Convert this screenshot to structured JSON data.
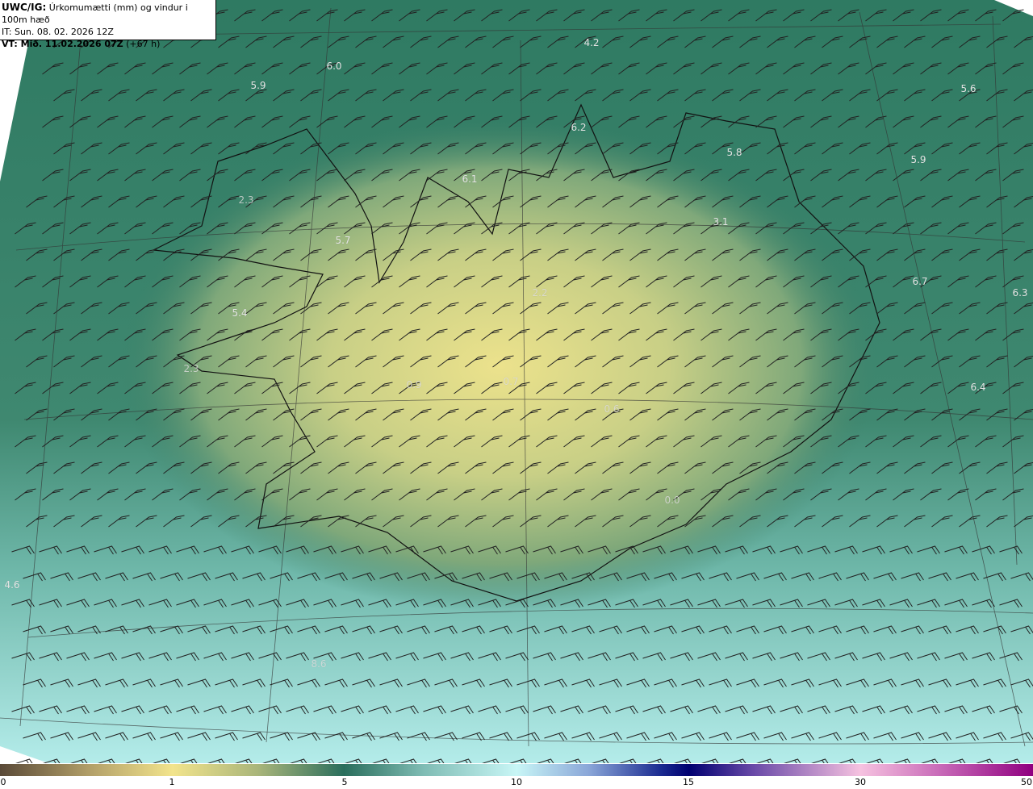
{
  "header": {
    "model": "UWC/IG:",
    "title": "Úrkomumætti (mm) og vindur i 100m hæð",
    "init_time": "IT: Sun. 08. 02. 2026 12Z",
    "valid_label": "VT: Mið. 11.02.2026 07Z",
    "lead": "(+67 h)"
  },
  "value_labels": [
    "4.2",
    "6.0",
    "5.9",
    "5.6",
    "6.2",
    "5.8",
    "5.9",
    "6.1",
    "2.3",
    "3.1",
    "5.7",
    "6.7",
    "6.3",
    "2.2",
    "5.4",
    "2.3",
    "0.7",
    "0.9",
    "0.6",
    "6.4",
    "0.0",
    "4.6",
    "8.6"
  ],
  "colorbar": {
    "ticks": [
      "0",
      "1",
      "5",
      "10",
      "15",
      "30",
      "50"
    ],
    "colors": [
      "#5a4a38",
      "#f2e48c",
      "#2a6e5c",
      "#c8f6f6",
      "#000070",
      "#f6c2e0",
      "#900080"
    ]
  }
}
